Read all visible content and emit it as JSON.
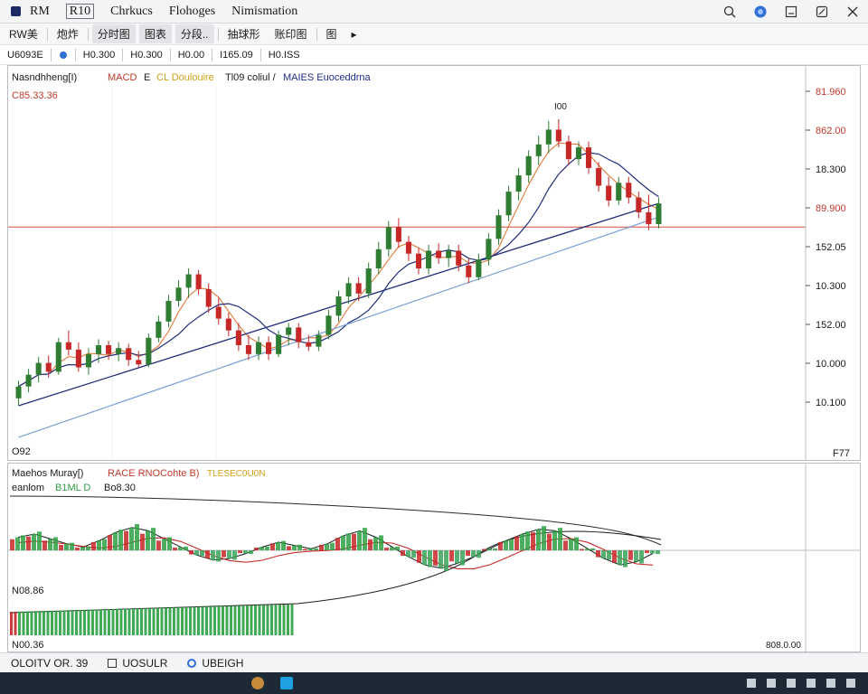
{
  "window": {
    "title_items": [
      "RM",
      "R10",
      "Chrkucs",
      "Flohoges",
      "Nimismation"
    ],
    "title_boxed": [
      false,
      true,
      false,
      false,
      false
    ]
  },
  "toolbar1": {
    "items": [
      "RW美",
      "炮炸",
      "分时图",
      "图表",
      "分段..",
      "抽球形",
      "账印图",
      "图"
    ],
    "shaded": [
      false,
      false,
      true,
      true,
      true,
      false,
      false,
      false
    ]
  },
  "toolbar2": {
    "cells": [
      "U6093E",
      "",
      "H0.300",
      "H0.300",
      "H0.00",
      "I165.09",
      "H0.ISS"
    ]
  },
  "price_chart": {
    "legend": [
      {
        "text": "Nasndhheng[I)",
        "color": "#1a1a1a"
      },
      {
        "text": "MACD",
        "color": "#c0392b"
      },
      {
        "text": "E",
        "color": "#1a1a1a"
      },
      {
        "text": "CL Doulouire",
        "color": "#d4a017"
      },
      {
        "text": "Tl09 coliul /",
        "color": "#1a1a1a"
      },
      {
        "text": "MAIES Euoceddrna",
        "color": "#1f2d8a"
      }
    ],
    "top_left_value": "C85.33.36",
    "peak_label": "I00",
    "bottom_left_label": "O92",
    "bottom_right_label": "F77",
    "price_axis_labels": [
      "81.960",
      "862.00",
      "18.300",
      "89.900",
      "152.05",
      "10.300",
      "152.00",
      "10.000",
      "10.100"
    ],
    "price_axis_colors": [
      "#c0392b",
      "#c0392b",
      "#1a1a1a",
      "#c0392b",
      "#1a1a1a",
      "#1a1a1a",
      "#1a1a1a",
      "#1a1a1a",
      "#1a1a1a"
    ]
  },
  "indicator_chart": {
    "legend": [
      {
        "text": "Maehos Muray[)",
        "color": "#1a1a1a"
      },
      {
        "text": "RACE RNOCohte B)",
        "color": "#c0392b"
      },
      {
        "text": "TLESEC0U0N",
        "color": "#d4a017"
      }
    ],
    "legend2": [
      {
        "text": "eanlom",
        "color": "#1a1a1a"
      },
      {
        "text": "B1ML D",
        "color": "#2ea043"
      },
      {
        "text": "Bo8.30",
        "color": "#1a1a1a"
      }
    ],
    "left_label_1": "N08.86",
    "left_label_2": "N00.36",
    "right_label": "808.0.00"
  },
  "statusbar": {
    "items": [
      "OLOITV OR. 39",
      "UOSULR",
      "UBEIGH"
    ]
  },
  "chart_data": {
    "type": "candlestick",
    "title": "",
    "candles": [
      {
        "o": 10.04,
        "h": 10.16,
        "l": 9.99,
        "c": 10.12
      },
      {
        "o": 10.12,
        "h": 10.24,
        "l": 10.08,
        "c": 10.2
      },
      {
        "o": 10.2,
        "h": 10.32,
        "l": 10.15,
        "c": 10.28
      },
      {
        "o": 10.28,
        "h": 10.33,
        "l": 10.18,
        "c": 10.22
      },
      {
        "o": 10.22,
        "h": 10.45,
        "l": 10.2,
        "c": 10.42
      },
      {
        "o": 10.42,
        "h": 10.5,
        "l": 10.33,
        "c": 10.37
      },
      {
        "o": 10.37,
        "h": 10.42,
        "l": 10.22,
        "c": 10.25
      },
      {
        "o": 10.25,
        "h": 10.38,
        "l": 10.2,
        "c": 10.34
      },
      {
        "o": 10.34,
        "h": 10.44,
        "l": 10.28,
        "c": 10.4
      },
      {
        "o": 10.4,
        "h": 10.43,
        "l": 10.3,
        "c": 10.34
      },
      {
        "o": 10.34,
        "h": 10.42,
        "l": 10.29,
        "c": 10.38
      },
      {
        "o": 10.38,
        "h": 10.41,
        "l": 10.26,
        "c": 10.3
      },
      {
        "o": 10.3,
        "h": 10.36,
        "l": 10.25,
        "c": 10.27
      },
      {
        "o": 10.27,
        "h": 10.48,
        "l": 10.25,
        "c": 10.45
      },
      {
        "o": 10.45,
        "h": 10.6,
        "l": 10.42,
        "c": 10.56
      },
      {
        "o": 10.56,
        "h": 10.74,
        "l": 10.52,
        "c": 10.7
      },
      {
        "o": 10.7,
        "h": 10.84,
        "l": 10.66,
        "c": 10.79
      },
      {
        "o": 10.79,
        "h": 10.92,
        "l": 10.72,
        "c": 10.88
      },
      {
        "o": 10.88,
        "h": 10.91,
        "l": 10.74,
        "c": 10.78
      },
      {
        "o": 10.78,
        "h": 10.82,
        "l": 10.62,
        "c": 10.66
      },
      {
        "o": 10.66,
        "h": 10.72,
        "l": 10.54,
        "c": 10.58
      },
      {
        "o": 10.58,
        "h": 10.62,
        "l": 10.46,
        "c": 10.5
      },
      {
        "o": 10.5,
        "h": 10.55,
        "l": 10.36,
        "c": 10.4
      },
      {
        "o": 10.4,
        "h": 10.47,
        "l": 10.3,
        "c": 10.34
      },
      {
        "o": 10.34,
        "h": 10.46,
        "l": 10.3,
        "c": 10.42
      },
      {
        "o": 10.42,
        "h": 10.46,
        "l": 10.3,
        "c": 10.34
      },
      {
        "o": 10.34,
        "h": 10.5,
        "l": 10.32,
        "c": 10.47
      },
      {
        "o": 10.47,
        "h": 10.55,
        "l": 10.4,
        "c": 10.52
      },
      {
        "o": 10.52,
        "h": 10.55,
        "l": 10.38,
        "c": 10.42
      },
      {
        "o": 10.42,
        "h": 10.47,
        "l": 10.36,
        "c": 10.39
      },
      {
        "o": 10.39,
        "h": 10.5,
        "l": 10.36,
        "c": 10.47
      },
      {
        "o": 10.47,
        "h": 10.64,
        "l": 10.44,
        "c": 10.6
      },
      {
        "o": 10.6,
        "h": 10.77,
        "l": 10.56,
        "c": 10.73
      },
      {
        "o": 10.73,
        "h": 10.86,
        "l": 10.68,
        "c": 10.82
      },
      {
        "o": 10.82,
        "h": 10.86,
        "l": 10.7,
        "c": 10.75
      },
      {
        "o": 10.75,
        "h": 10.96,
        "l": 10.72,
        "c": 10.92
      },
      {
        "o": 10.92,
        "h": 11.1,
        "l": 10.88,
        "c": 11.05
      },
      {
        "o": 11.05,
        "h": 11.24,
        "l": 11.0,
        "c": 11.2
      },
      {
        "o": 11.2,
        "h": 11.26,
        "l": 11.06,
        "c": 11.1
      },
      {
        "o": 11.1,
        "h": 11.14,
        "l": 10.97,
        "c": 11.02
      },
      {
        "o": 11.02,
        "h": 11.06,
        "l": 10.88,
        "c": 10.92
      },
      {
        "o": 10.92,
        "h": 11.08,
        "l": 10.88,
        "c": 11.04
      },
      {
        "o": 11.04,
        "h": 11.09,
        "l": 10.95,
        "c": 10.99
      },
      {
        "o": 10.99,
        "h": 11.08,
        "l": 10.93,
        "c": 11.04
      },
      {
        "o": 11.04,
        "h": 11.08,
        "l": 10.9,
        "c": 10.94
      },
      {
        "o": 10.94,
        "h": 10.99,
        "l": 10.82,
        "c": 10.86
      },
      {
        "o": 10.86,
        "h": 11.02,
        "l": 10.84,
        "c": 10.98
      },
      {
        "o": 10.98,
        "h": 11.16,
        "l": 10.94,
        "c": 11.12
      },
      {
        "o": 11.12,
        "h": 11.32,
        "l": 11.08,
        "c": 11.28
      },
      {
        "o": 11.28,
        "h": 11.48,
        "l": 11.24,
        "c": 11.44
      },
      {
        "o": 11.44,
        "h": 11.6,
        "l": 11.38,
        "c": 11.55
      },
      {
        "o": 11.55,
        "h": 11.72,
        "l": 11.5,
        "c": 11.68
      },
      {
        "o": 11.68,
        "h": 11.82,
        "l": 11.62,
        "c": 11.76
      },
      {
        "o": 11.76,
        "h": 11.92,
        "l": 11.7,
        "c": 11.86
      },
      {
        "o": 11.86,
        "h": 11.93,
        "l": 11.74,
        "c": 11.78
      },
      {
        "o": 11.78,
        "h": 11.82,
        "l": 11.62,
        "c": 11.66
      },
      {
        "o": 11.66,
        "h": 11.78,
        "l": 11.62,
        "c": 11.74
      },
      {
        "o": 11.74,
        "h": 11.78,
        "l": 11.56,
        "c": 11.6
      },
      {
        "o": 11.6,
        "h": 11.64,
        "l": 11.44,
        "c": 11.48
      },
      {
        "o": 11.48,
        "h": 11.54,
        "l": 11.34,
        "c": 11.38
      },
      {
        "o": 11.38,
        "h": 11.54,
        "l": 11.35,
        "c": 11.5
      },
      {
        "o": 11.5,
        "h": 11.54,
        "l": 11.36,
        "c": 11.4
      },
      {
        "o": 11.4,
        "h": 11.44,
        "l": 11.26,
        "c": 11.3
      },
      {
        "o": 11.3,
        "h": 11.42,
        "l": 11.18,
        "c": 11.22
      },
      {
        "o": 11.22,
        "h": 11.4,
        "l": 11.19,
        "c": 11.36
      }
    ],
    "moving_averages": [
      "orange",
      "navy"
    ],
    "trendlines": 2,
    "horizontal_level": 11.2,
    "indicator": {
      "histogram": [
        0.4,
        0.5,
        0.35,
        0.2,
        0.1,
        0.3,
        0.55,
        0.7,
        0.6,
        0.35,
        0.1,
        -0.15,
        -0.3,
        -0.25,
        -0.1,
        0.1,
        0.25,
        0.15,
        0.05,
        0.2,
        0.45,
        0.6,
        0.4,
        0.1,
        -0.2,
        -0.45,
        -0.55,
        -0.4,
        -0.2,
        0.05,
        0.3,
        0.5,
        0.65,
        0.6,
        0.35,
        0.05,
        -0.25,
        -0.45,
        -0.35,
        -0.1
      ]
    }
  }
}
